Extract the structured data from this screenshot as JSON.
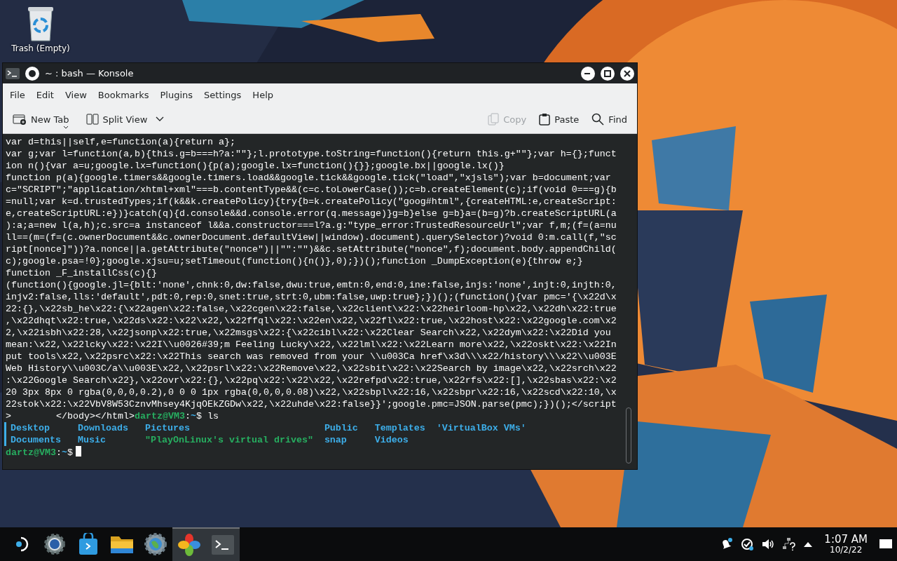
{
  "desktop": {
    "icons": [
      {
        "label": "Trash (Empty)",
        "kind": "trash"
      }
    ]
  },
  "window": {
    "title": "~ : bash — Konsole",
    "menu": [
      "File",
      "Edit",
      "View",
      "Bookmarks",
      "Plugins",
      "Settings",
      "Help"
    ],
    "toolbar_left": [
      {
        "label": "New Tab",
        "kind": "new-tab",
        "disabled": false
      },
      {
        "label": "Split View",
        "kind": "split-view",
        "disabled": false
      }
    ],
    "toolbar_right": [
      {
        "label": "Copy",
        "kind": "copy",
        "disabled": true
      },
      {
        "label": "Paste",
        "kind": "paste",
        "disabled": false
      },
      {
        "label": "Find",
        "kind": "find",
        "disabled": false
      }
    ]
  },
  "terminal": {
    "lines": [
      "var d=this||self,e=function(a){return a};",
      "var g;var l=function(a,b){this.g=b===h?a:\"\"};l.prototype.toString=function(){return this.g+\"\"};var h={};funct",
      "ion n(){var a=u;google.lx=function(){p(a);google.lx=function(){}};google.bx||google.lx()}",
      "function p(a){google.timers&&google.timers.load&&google.tick&&google.tick(\"load\",\"xjsls\");var b=document;var",
      "c=\"SCRIPT\";\"application/xhtml+xml\"===b.contentType&&(c=c.toLowerCase());c=b.createElement(c);if(void 0===g){b",
      "=null;var k=d.trustedTypes;if(k&&k.createPolicy){try{b=k.createPolicy(\"goog#html\",{createHTML:e,createScript:",
      "e,createScriptURL:e})}catch(q){d.console&&d.console.error(q.message)}g=b}else g=b}a=(b=g)?b.createScriptURL(a",
      "):a;a=new l(a,h);c.src=a instanceof l&&a.constructor===l?a.g:\"type_error:TrustedResourceUrl\";var f,m;(f=(a=nu",
      "ll==(m=(f=(c.ownerDocument&&c.ownerDocument.defaultView||window).document).querySelector)?void 0:m.call(f,\"sc",
      "ript[nonce]\"))?a.nonce||a.getAttribute(\"nonce\")||\"\":\"\")&&c.setAttribute(\"nonce\",f);document.body.appendChild(",
      "c);google.psa=!0};google.xjsu=u;setTimeout(function(){n()},0);})();function _DumpException(e){throw e;}",
      "function _F_installCss(c){}",
      "(function(){google.jl={blt:'none',chnk:0,dw:false,dwu:true,emtn:0,end:0,ine:false,injs:'none',injt:0,injth:0,",
      "injv2:false,lls:'default',pdt:0,rep:0,snet:true,strt:0,ubm:false,uwp:true};})();(function(){var pmc='{\\x22d\\x",
      "22:{},\\x22sb_he\\x22:{\\x22agen\\x22:false,\\x22cgen\\x22:false,\\x22client\\x22:\\x22heirloom-hp\\x22,\\x22dh\\x22:true",
      ",\\x22dhqt\\x22:true,\\x22ds\\x22:\\x22\\x22,\\x22ffql\\x22:\\x22en\\x22,\\x22fl\\x22:true,\\x22host\\x22:\\x22google.com\\x2",
      "2,\\x22isbh\\x22:28,\\x22jsonp\\x22:true,\\x22msgs\\x22:{\\x22cibl\\x22:\\x22Clear Search\\x22,\\x22dym\\x22:\\x22Did you",
      "mean:\\x22,\\x22lcky\\x22:\\x22I\\\\u0026#39;m Feeling Lucky\\x22,\\x22lml\\x22:\\x22Learn more\\x22,\\x22oskt\\x22:\\x22In",
      "put tools\\x22,\\x22psrc\\x22:\\x22This search was removed from your \\\\u003Ca href\\x3d\\\\\\x22/history\\\\\\x22\\\\u003E",
      "Web History\\\\u003C/a\\\\u003E\\x22,\\x22psrl\\x22:\\x22Remove\\x22,\\x22sbit\\x22:\\x22Search by image\\x22,\\x22srch\\x22",
      ":\\x22Google Search\\x22},\\x22ovr\\x22:{},\\x22pq\\x22:\\x22\\x22,\\x22refpd\\x22:true,\\x22rfs\\x22:[],\\x22sbas\\x22:\\x2",
      "20 3px 8px 0 rgba(0,0,0,0.2),0 0 0 1px rgba(0,0,0,0.08)\\x22,\\x22sbpl\\x22:16,\\x22sbpr\\x22:16,\\x22scd\\x22:10,\\x",
      "22stok\\x22:\\x22VbV8W53CznvMhsey4KjqOEkZGDw\\x22,\\x22uhde\\x22:false}}';google.pmc=JSON.parse(pmc);})();</script"
    ],
    "command_prompt": {
      "before": ">        </body></html>",
      "user": "dartz@VM3",
      "sep": ":",
      "path": "~",
      "symbol": "$",
      "command": "ls"
    },
    "ls_output": [
      [
        {
          "name": "Desktop",
          "kind": "dir"
        },
        {
          "name": "Downloads",
          "kind": "dir"
        },
        {
          "name": "Pictures",
          "kind": "dir"
        },
        {
          "name": "Public",
          "kind": "dir"
        },
        {
          "name": "Templates",
          "kind": "dir"
        },
        {
          "name": "'VirtualBox VMs'",
          "kind": "dir"
        }
      ],
      [
        {
          "name": "Documents",
          "kind": "dir"
        },
        {
          "name": "Music",
          "kind": "dir"
        },
        {
          "name": "\"PlayOnLinux's virtual drives\"",
          "kind": "quoted"
        },
        {
          "name": "snap",
          "kind": "dir"
        },
        {
          "name": "Videos",
          "kind": "dir"
        }
      ]
    ],
    "current_prompt": {
      "user": "dartz@VM3",
      "sep": ":",
      "path": "~",
      "symbol": "$"
    }
  },
  "taskbar": {
    "apps": [
      {
        "kind": "launcher",
        "active": false
      },
      {
        "kind": "settings",
        "active": false
      },
      {
        "kind": "store",
        "active": false
      },
      {
        "kind": "files",
        "active": false
      },
      {
        "kind": "globe-gear",
        "active": false
      },
      {
        "kind": "clover",
        "active": true
      },
      {
        "kind": "terminal",
        "active": true
      }
    ],
    "tray": [
      {
        "kind": "bell"
      },
      {
        "kind": "update"
      },
      {
        "kind": "volume"
      },
      {
        "kind": "network"
      },
      {
        "kind": "expand"
      }
    ],
    "clock": {
      "time": "1:07 AM",
      "date": "10/2/22"
    }
  }
}
